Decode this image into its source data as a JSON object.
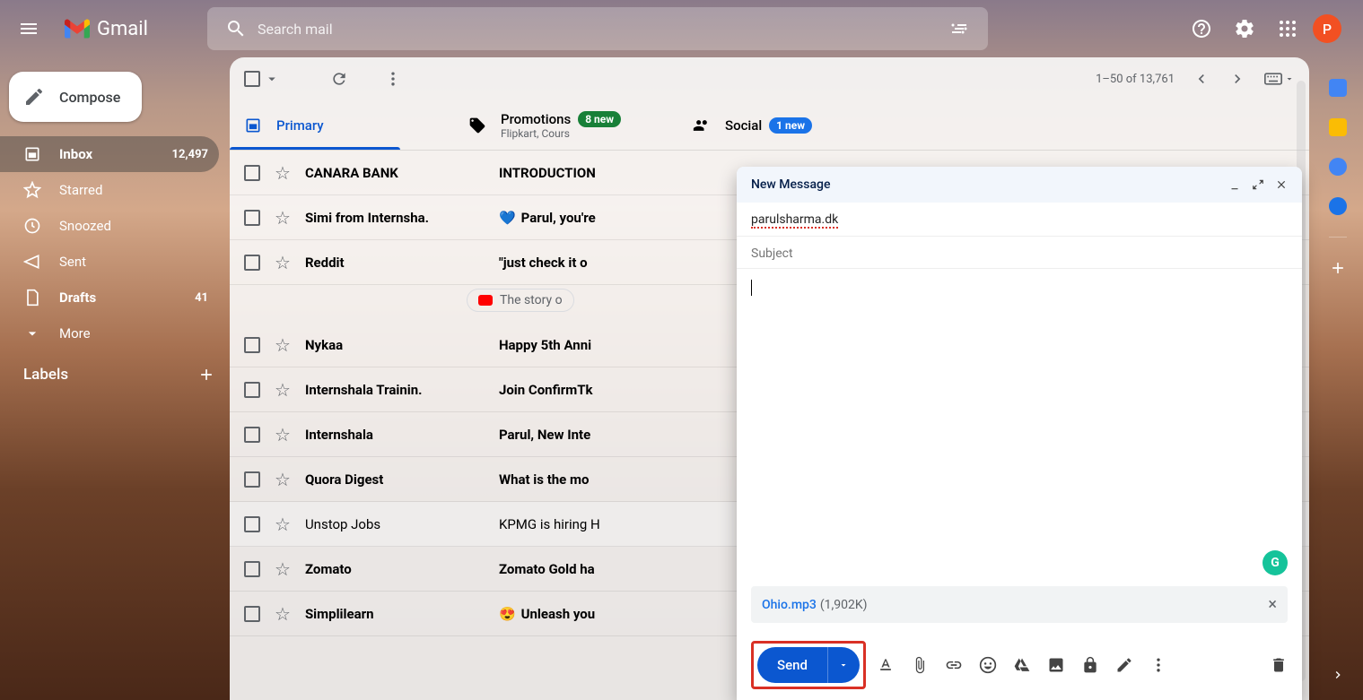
{
  "header": {
    "app_name": "Gmail",
    "search_placeholder": "Search mail",
    "avatar_initial": "P"
  },
  "sidebar": {
    "compose_label": "Compose",
    "items": [
      {
        "label": "Inbox",
        "count": "12,497",
        "active": true,
        "bold": true
      },
      {
        "label": "Starred",
        "count": ""
      },
      {
        "label": "Snoozed",
        "count": ""
      },
      {
        "label": "Sent",
        "count": ""
      },
      {
        "label": "Drafts",
        "count": "41",
        "bold": true
      },
      {
        "label": "More",
        "count": ""
      }
    ],
    "labels_header": "Labels"
  },
  "toolbar": {
    "pagination": "1–50 of 13,761"
  },
  "tabs": [
    {
      "label": "Primary",
      "active": true
    },
    {
      "label": "Promotions",
      "badge": "8 new",
      "sub": "Flipkart, Cours"
    },
    {
      "label": "Social",
      "badge": "1 new",
      "badge_color": "blue"
    }
  ],
  "emails": [
    {
      "sender": "CANARA BANK",
      "subject": "INTRODUCTION",
      "unread": true
    },
    {
      "sender": "Simi from Internsha.",
      "subject": "Parul, you're",
      "emoji": "💙",
      "unread": true
    },
    {
      "sender": "Reddit",
      "subject": "\"just check it o",
      "unread": true,
      "chip": "The story o"
    },
    {
      "sender": "Nykaa",
      "subject": "Happy 5th Anni",
      "unread": true
    },
    {
      "sender": "Internshala Trainin.",
      "subject": "Join ConfirmTk",
      "unread": true
    },
    {
      "sender": "Internshala",
      "subject": "Parul, New Inte",
      "unread": true
    },
    {
      "sender": "Quora Digest",
      "subject": "What is the mo",
      "unread": true
    },
    {
      "sender": "Unstop Jobs",
      "subject": "KPMG is hiring H",
      "unread": false
    },
    {
      "sender": "Zomato",
      "subject": "Zomato Gold ha",
      "unread": true
    },
    {
      "sender": "Simplilearn",
      "subject": "Unleash you",
      "emoji": "😍",
      "unread": true
    }
  ],
  "compose": {
    "title": "New Message",
    "to": "parulsharma.dk",
    "subject_placeholder": "Subject",
    "attachment_name": "Ohio.mp3",
    "attachment_size": "(1,902K)",
    "send_label": "Send"
  }
}
